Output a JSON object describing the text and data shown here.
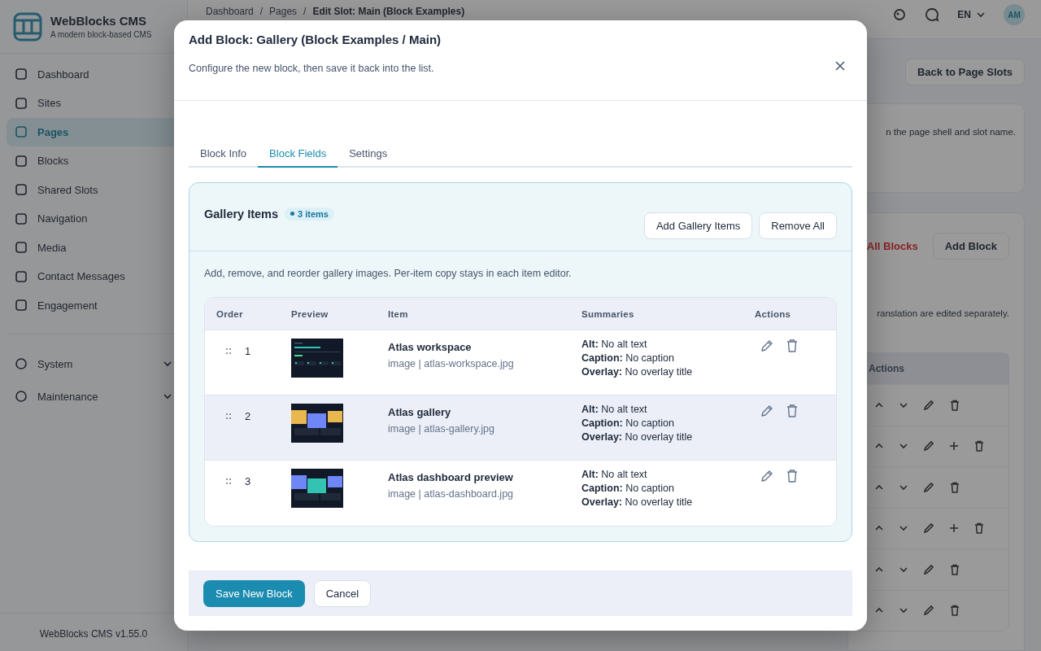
{
  "app": {
    "name": "WebBlocks CMS",
    "tagline": "A modern block-based CMS",
    "version": "WebBlocks CMS v1.55.0"
  },
  "sidebar": {
    "items": [
      {
        "label": "Dashboard",
        "selected": false
      },
      {
        "label": "Sites",
        "selected": false
      },
      {
        "label": "Pages",
        "selected": true
      },
      {
        "label": "Blocks",
        "selected": false
      },
      {
        "label": "Shared Slots",
        "selected": false
      },
      {
        "label": "Navigation",
        "selected": false
      },
      {
        "label": "Media",
        "selected": false
      },
      {
        "label": "Contact Messages",
        "selected": false
      },
      {
        "label": "Engagement",
        "selected": false
      }
    ],
    "groups": [
      {
        "label": "System",
        "expanded": false
      },
      {
        "label": "Maintenance",
        "expanded": false
      }
    ]
  },
  "topbar": {
    "separator": "/",
    "breadcrumb": [
      "Dashboard",
      "Pages",
      "Edit Slot: Main (Block Examples)"
    ],
    "language": "EN",
    "avatar": "AM"
  },
  "page": {
    "back_button": "Back to Page Slots",
    "note_fragment": "n the page shell and slot name.",
    "remove_fragment": "All Blocks",
    "add_block": "Add Block",
    "translation_fragment": "ranslation are edited separately.",
    "table_header": "Actions",
    "rows": [
      {
        "can_add": false
      },
      {
        "can_add": true
      },
      {
        "can_add": false
      },
      {
        "can_add": true
      },
      {
        "can_add": false
      },
      {
        "can_add": false
      }
    ]
  },
  "modal": {
    "title": "Add Block: Gallery (Block Examples / Main)",
    "subtitle": "Configure the new block, then save it back into the list.",
    "tabs": [
      {
        "label": "Block Info",
        "selected": false
      },
      {
        "label": "Block Fields",
        "selected": true
      },
      {
        "label": "Settings",
        "selected": false
      }
    ],
    "panel": {
      "title": "Gallery Items",
      "count_badge": "3 items",
      "buttons": [
        "Add Gallery Items",
        "Remove All"
      ],
      "hint": "Add, remove, and reorder gallery images. Per-item copy stays in each item editor.",
      "columns": [
        "Order",
        "Preview",
        "Item",
        "Summaries",
        "Actions"
      ],
      "rows": [
        {
          "order": "1",
          "kind": "workspace",
          "title": "Atlas workspace",
          "meta": "image | atlas-workspace.jpg",
          "selected": false,
          "summaries": [
            "**Alt:** No alt text",
            "**Caption:** No caption",
            "**Overlay:** No overlay title"
          ]
        },
        {
          "order": "2",
          "kind": "gallery",
          "title": "Atlas gallery",
          "meta": "image | atlas-gallery.jpg",
          "selected": true,
          "summaries": [
            "**Alt:** No alt text",
            "**Caption:** No caption",
            "**Overlay:** No overlay title"
          ]
        },
        {
          "order": "3",
          "kind": "dashboard",
          "title": "Atlas dashboard preview",
          "meta": "image | atlas-dashboard.jpg",
          "selected": false,
          "summaries": [
            "**Alt:** No alt text",
            "**Caption:** No caption",
            "**Overlay:** No overlay title"
          ]
        }
      ]
    },
    "footer": {
      "save": "Save New Block",
      "cancel": "Cancel"
    }
  }
}
